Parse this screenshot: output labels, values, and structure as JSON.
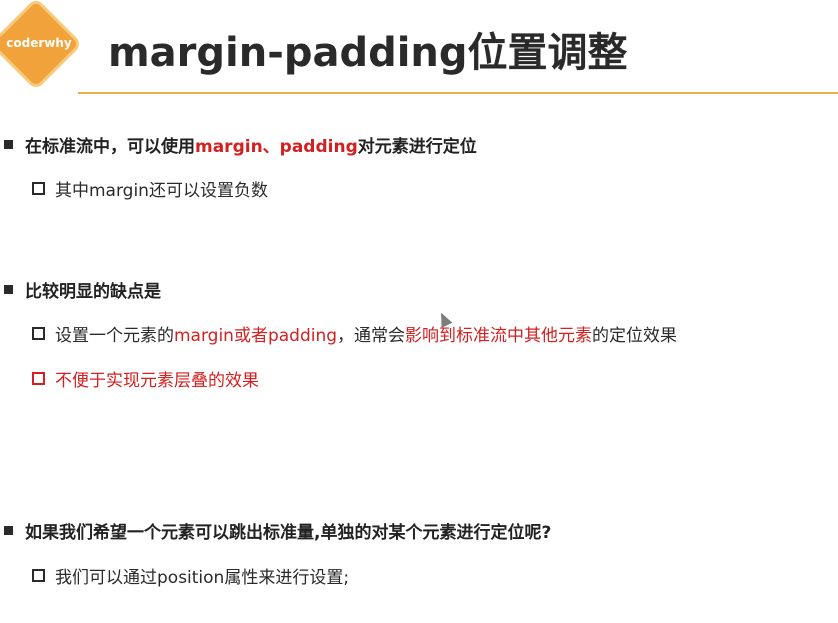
{
  "logo": {
    "text": "coderwhy"
  },
  "title": "margin-padding位置调整",
  "bullets": [
    {
      "parts": [
        "在标准流中，可以使用",
        "margin、padding",
        "对元素进行定位"
      ],
      "sub": [
        {
          "parts": [
            "其中margin还可以设置负数"
          ]
        }
      ]
    },
    {
      "parts": [
        "比较明显的缺点是"
      ],
      "sub": [
        {
          "parts": [
            "设置一个元素的",
            "margin或者padding",
            "，通常会",
            "影响到标准流中其他元素",
            "的定位效果"
          ]
        },
        {
          "parts": [
            "不便于实现元素层叠的效果"
          ]
        }
      ]
    },
    {
      "parts": [
        "如果我们希望一个元素可以跳出标准量,单独的对某个元素进行定位呢?"
      ],
      "sub": [
        {
          "parts": [
            "我们可以通过position属性来进行设置;"
          ]
        }
      ]
    }
  ],
  "colors": {
    "accent": "#d42020",
    "rule": "#e7b04a",
    "logo": "#f2a23a"
  }
}
